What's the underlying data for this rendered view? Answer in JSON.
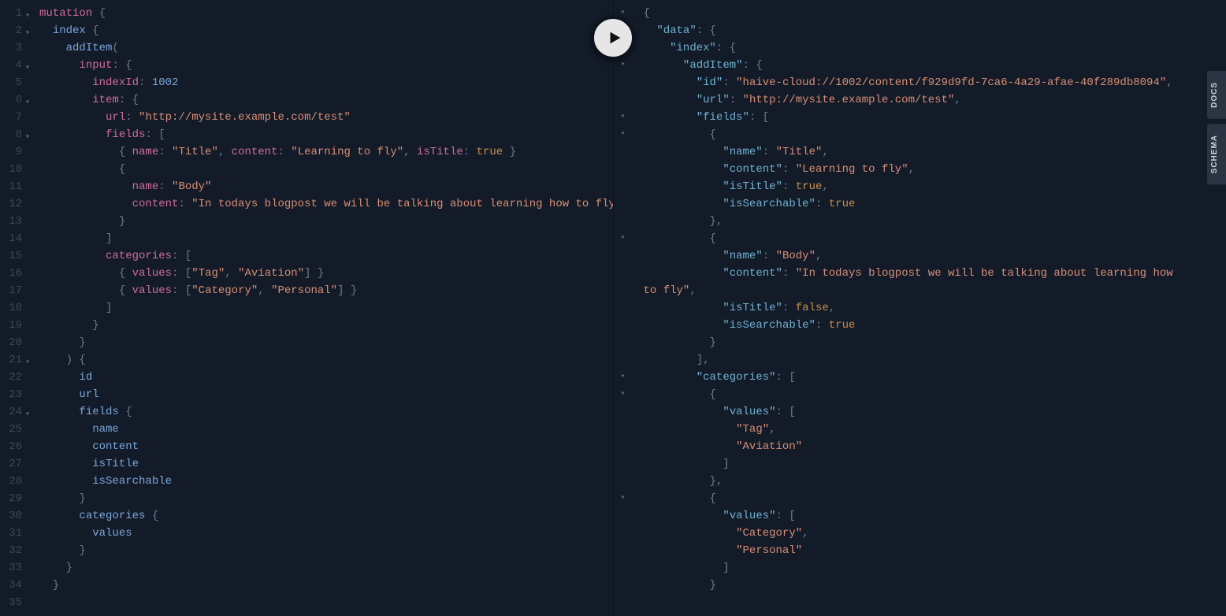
{
  "side_tabs": {
    "docs": "DOCS",
    "schema": "SCHEMA"
  },
  "play_label": "Execute Query",
  "query": {
    "lines": [
      {
        "n": 1,
        "fold": true,
        "tokens": [
          [
            "kw",
            "mutation"
          ],
          [
            "punc",
            " {"
          ]
        ]
      },
      {
        "n": 2,
        "fold": true,
        "tokens": [
          [
            "punc",
            "  "
          ],
          [
            "field",
            "index"
          ],
          [
            "punc",
            " {"
          ]
        ]
      },
      {
        "n": 3,
        "tokens": [
          [
            "punc",
            "    "
          ],
          [
            "field",
            "addItem"
          ],
          [
            "punc",
            "("
          ]
        ]
      },
      {
        "n": 4,
        "fold": true,
        "tokens": [
          [
            "punc",
            "      "
          ],
          [
            "attr",
            "input"
          ],
          [
            "punc",
            ": {"
          ]
        ]
      },
      {
        "n": 5,
        "tokens": [
          [
            "punc",
            "        "
          ],
          [
            "attr",
            "indexId"
          ],
          [
            "punc",
            ": "
          ],
          [
            "num",
            "1002"
          ]
        ]
      },
      {
        "n": 6,
        "fold": true,
        "tokens": [
          [
            "punc",
            "        "
          ],
          [
            "attr",
            "item"
          ],
          [
            "punc",
            ": {"
          ]
        ]
      },
      {
        "n": 7,
        "tokens": [
          [
            "punc",
            "          "
          ],
          [
            "attr",
            "url"
          ],
          [
            "punc",
            ": "
          ],
          [
            "str",
            "\"http://mysite.example.com/test\""
          ]
        ]
      },
      {
        "n": 8,
        "fold": true,
        "tokens": [
          [
            "punc",
            "          "
          ],
          [
            "attr",
            "fields"
          ],
          [
            "punc",
            ": ["
          ]
        ]
      },
      {
        "n": 9,
        "tokens": [
          [
            "punc",
            "            { "
          ],
          [
            "attr",
            "name"
          ],
          [
            "punc",
            ": "
          ],
          [
            "str",
            "\"Title\""
          ],
          [
            "punc",
            ", "
          ],
          [
            "attr",
            "content"
          ],
          [
            "punc",
            ": "
          ],
          [
            "str",
            "\"Learning to fly\""
          ],
          [
            "punc",
            ", "
          ],
          [
            "attr",
            "isTitle"
          ],
          [
            "punc",
            ": "
          ],
          [
            "bool",
            "true"
          ],
          [
            "punc",
            " }"
          ]
        ]
      },
      {
        "n": 10,
        "tokens": [
          [
            "punc",
            "            {"
          ]
        ]
      },
      {
        "n": 11,
        "tokens": [
          [
            "punc",
            "              "
          ],
          [
            "attr",
            "name"
          ],
          [
            "punc",
            ": "
          ],
          [
            "str",
            "\"Body\""
          ]
        ]
      },
      {
        "n": 12,
        "tokens": [
          [
            "punc",
            "              "
          ],
          [
            "attr",
            "content"
          ],
          [
            "punc",
            ": "
          ],
          [
            "str",
            "\"In todays blogpost we will be talking about learning how to fly\""
          ]
        ]
      },
      {
        "n": 13,
        "tokens": [
          [
            "punc",
            "            }"
          ]
        ]
      },
      {
        "n": 14,
        "tokens": [
          [
            "punc",
            "          ]"
          ]
        ]
      },
      {
        "n": 15,
        "tokens": [
          [
            "punc",
            "          "
          ],
          [
            "attr",
            "categories"
          ],
          [
            "punc",
            ": ["
          ]
        ]
      },
      {
        "n": 16,
        "tokens": [
          [
            "punc",
            "            { "
          ],
          [
            "attr",
            "values"
          ],
          [
            "punc",
            ": ["
          ],
          [
            "str",
            "\"Tag\""
          ],
          [
            "punc",
            ", "
          ],
          [
            "str",
            "\"Aviation\""
          ],
          [
            "punc",
            "] }"
          ]
        ]
      },
      {
        "n": 17,
        "tokens": [
          [
            "punc",
            "            { "
          ],
          [
            "attr",
            "values"
          ],
          [
            "punc",
            ": ["
          ],
          [
            "str",
            "\"Category\""
          ],
          [
            "punc",
            ", "
          ],
          [
            "str",
            "\"Personal\""
          ],
          [
            "punc",
            "] }"
          ]
        ]
      },
      {
        "n": 18,
        "tokens": [
          [
            "punc",
            "          ]"
          ]
        ]
      },
      {
        "n": 19,
        "tokens": [
          [
            "punc",
            "        }"
          ]
        ]
      },
      {
        "n": 20,
        "tokens": [
          [
            "punc",
            "      }"
          ]
        ]
      },
      {
        "n": 21,
        "fold": true,
        "tokens": [
          [
            "punc",
            "    ) {"
          ]
        ]
      },
      {
        "n": 22,
        "tokens": [
          [
            "punc",
            "      "
          ],
          [
            "field",
            "id"
          ]
        ]
      },
      {
        "n": 23,
        "tokens": [
          [
            "punc",
            "      "
          ],
          [
            "field",
            "url"
          ]
        ]
      },
      {
        "n": 24,
        "fold": true,
        "tokens": [
          [
            "punc",
            "      "
          ],
          [
            "field",
            "fields"
          ],
          [
            "punc",
            " {"
          ]
        ]
      },
      {
        "n": 25,
        "tokens": [
          [
            "punc",
            "        "
          ],
          [
            "field",
            "name"
          ]
        ]
      },
      {
        "n": 26,
        "tokens": [
          [
            "punc",
            "        "
          ],
          [
            "field",
            "content"
          ]
        ]
      },
      {
        "n": 27,
        "tokens": [
          [
            "punc",
            "        "
          ],
          [
            "field",
            "isTitle"
          ]
        ]
      },
      {
        "n": 28,
        "tokens": [
          [
            "punc",
            "        "
          ],
          [
            "field",
            "isSearchable"
          ]
        ]
      },
      {
        "n": 29,
        "tokens": [
          [
            "punc",
            "      }"
          ]
        ]
      },
      {
        "n": 30,
        "tokens": [
          [
            "punc",
            "      "
          ],
          [
            "field",
            "categories"
          ],
          [
            "punc",
            " {"
          ]
        ]
      },
      {
        "n": 31,
        "tokens": [
          [
            "punc",
            "        "
          ],
          [
            "field",
            "values"
          ]
        ]
      },
      {
        "n": 32,
        "tokens": [
          [
            "punc",
            "      }"
          ]
        ]
      },
      {
        "n": 33,
        "tokens": [
          [
            "punc",
            "    }"
          ]
        ]
      },
      {
        "n": 34,
        "tokens": [
          [
            "punc",
            "  }"
          ]
        ]
      },
      {
        "n": 35,
        "tokens": [
          [
            "punc",
            ""
          ]
        ]
      }
    ]
  },
  "response": {
    "lines": [
      {
        "fold": true,
        "tokens": [
          [
            "punc",
            "{"
          ]
        ]
      },
      {
        "fold": true,
        "tokens": [
          [
            "punc",
            "  "
          ],
          [
            "key",
            "\"data\""
          ],
          [
            "punc",
            ": {"
          ]
        ]
      },
      {
        "fold": true,
        "tokens": [
          [
            "punc",
            "    "
          ],
          [
            "key",
            "\"index\""
          ],
          [
            "punc",
            ": {"
          ]
        ]
      },
      {
        "fold": true,
        "tokens": [
          [
            "punc",
            "      "
          ],
          [
            "key",
            "\"addItem\""
          ],
          [
            "punc",
            ": {"
          ]
        ]
      },
      {
        "tokens": [
          [
            "punc",
            "        "
          ],
          [
            "key",
            "\"id\""
          ],
          [
            "punc",
            ": "
          ],
          [
            "str",
            "\"haive-cloud://1002/content/f929d9fd-7ca6-4a29-afae-40f289db8094\""
          ],
          [
            "punc",
            ","
          ]
        ]
      },
      {
        "tokens": [
          [
            "punc",
            "        "
          ],
          [
            "key",
            "\"url\""
          ],
          [
            "punc",
            ": "
          ],
          [
            "str",
            "\"http://mysite.example.com/test\""
          ],
          [
            "punc",
            ","
          ]
        ]
      },
      {
        "fold": true,
        "tokens": [
          [
            "punc",
            "        "
          ],
          [
            "key",
            "\"fields\""
          ],
          [
            "punc",
            ": ["
          ]
        ]
      },
      {
        "fold": true,
        "tokens": [
          [
            "punc",
            "          {"
          ]
        ]
      },
      {
        "tokens": [
          [
            "punc",
            "            "
          ],
          [
            "key",
            "\"name\""
          ],
          [
            "punc",
            ": "
          ],
          [
            "str",
            "\"Title\""
          ],
          [
            "punc",
            ","
          ]
        ]
      },
      {
        "tokens": [
          [
            "punc",
            "            "
          ],
          [
            "key",
            "\"content\""
          ],
          [
            "punc",
            ": "
          ],
          [
            "str",
            "\"Learning to fly\""
          ],
          [
            "punc",
            ","
          ]
        ]
      },
      {
        "tokens": [
          [
            "punc",
            "            "
          ],
          [
            "key",
            "\"isTitle\""
          ],
          [
            "punc",
            ": "
          ],
          [
            "bool",
            "true"
          ],
          [
            "punc",
            ","
          ]
        ]
      },
      {
        "tokens": [
          [
            "punc",
            "            "
          ],
          [
            "key",
            "\"isSearchable\""
          ],
          [
            "punc",
            ": "
          ],
          [
            "bool",
            "true"
          ]
        ]
      },
      {
        "tokens": [
          [
            "punc",
            "          },"
          ]
        ]
      },
      {
        "fold": true,
        "tokens": [
          [
            "punc",
            "          {"
          ]
        ]
      },
      {
        "tokens": [
          [
            "punc",
            "            "
          ],
          [
            "key",
            "\"name\""
          ],
          [
            "punc",
            ": "
          ],
          [
            "str",
            "\"Body\""
          ],
          [
            "punc",
            ","
          ]
        ]
      },
      {
        "tokens": [
          [
            "punc",
            "            "
          ],
          [
            "key",
            "\"content\""
          ],
          [
            "punc",
            ": "
          ],
          [
            "str",
            "\"In todays blogpost we will be talking about learning how "
          ]
        ]
      },
      {
        "tokens": [
          [
            "str",
            "to fly\""
          ],
          [
            "punc",
            ","
          ]
        ]
      },
      {
        "tokens": [
          [
            "punc",
            "            "
          ],
          [
            "key",
            "\"isTitle\""
          ],
          [
            "punc",
            ": "
          ],
          [
            "bool",
            "false"
          ],
          [
            "punc",
            ","
          ]
        ]
      },
      {
        "tokens": [
          [
            "punc",
            "            "
          ],
          [
            "key",
            "\"isSearchable\""
          ],
          [
            "punc",
            ": "
          ],
          [
            "bool",
            "true"
          ]
        ]
      },
      {
        "tokens": [
          [
            "punc",
            "          }"
          ]
        ]
      },
      {
        "tokens": [
          [
            "punc",
            "        ],"
          ]
        ]
      },
      {
        "fold": true,
        "tokens": [
          [
            "punc",
            "        "
          ],
          [
            "key",
            "\"categories\""
          ],
          [
            "punc",
            ": ["
          ]
        ]
      },
      {
        "fold": true,
        "tokens": [
          [
            "punc",
            "          {"
          ]
        ]
      },
      {
        "tokens": [
          [
            "punc",
            "            "
          ],
          [
            "key",
            "\"values\""
          ],
          [
            "punc",
            ": ["
          ]
        ]
      },
      {
        "tokens": [
          [
            "punc",
            "              "
          ],
          [
            "str",
            "\"Tag\""
          ],
          [
            "punc",
            ","
          ]
        ]
      },
      {
        "tokens": [
          [
            "punc",
            "              "
          ],
          [
            "str",
            "\"Aviation\""
          ]
        ]
      },
      {
        "tokens": [
          [
            "punc",
            "            ]"
          ]
        ]
      },
      {
        "tokens": [
          [
            "punc",
            "          },"
          ]
        ]
      },
      {
        "fold": true,
        "tokens": [
          [
            "punc",
            "          {"
          ]
        ]
      },
      {
        "tokens": [
          [
            "punc",
            "            "
          ],
          [
            "key",
            "\"values\""
          ],
          [
            "punc",
            ": ["
          ]
        ]
      },
      {
        "tokens": [
          [
            "punc",
            "              "
          ],
          [
            "str",
            "\"Category\""
          ],
          [
            "punc",
            ","
          ]
        ]
      },
      {
        "tokens": [
          [
            "punc",
            "              "
          ],
          [
            "str",
            "\"Personal\""
          ]
        ]
      },
      {
        "tokens": [
          [
            "punc",
            "            ]"
          ]
        ]
      },
      {
        "tokens": [
          [
            "punc",
            "          }"
          ]
        ]
      }
    ]
  }
}
